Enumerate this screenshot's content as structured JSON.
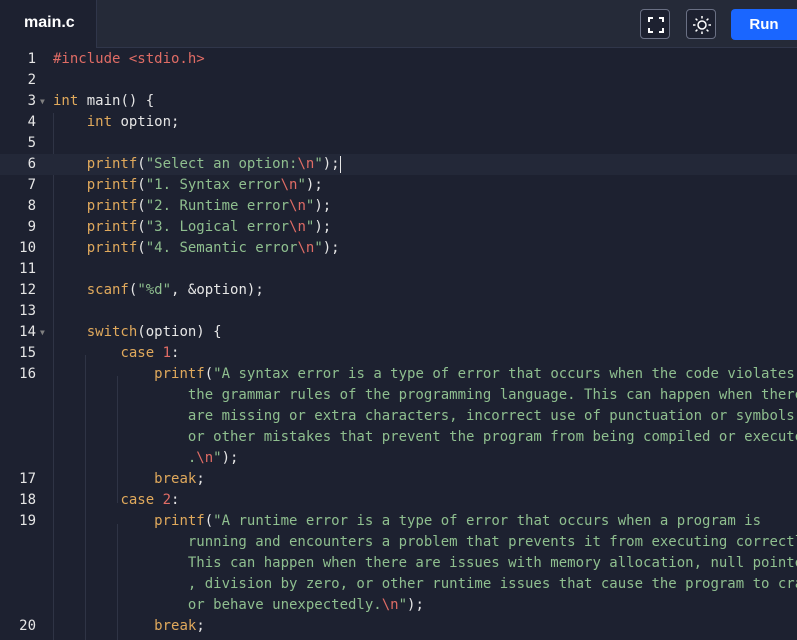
{
  "tab": {
    "filename": "main.c"
  },
  "toolbar": {
    "fullscreen_icon": "fullscreen-icon",
    "theme_icon": "sun-icon",
    "run_label": "Run"
  },
  "colors": {
    "background": "#1d2130",
    "run_button": "#1a66ff",
    "keyword": "#e0a95c",
    "string": "#8fbf8f",
    "escape": "#e06c65"
  },
  "editor": {
    "lines": [
      {
        "n": "1",
        "code": "#include <stdio.h>"
      },
      {
        "n": "2",
        "code": ""
      },
      {
        "n": "3",
        "code": "int main() {"
      },
      {
        "n": "4",
        "code": "    int option;"
      },
      {
        "n": "5",
        "code": ""
      },
      {
        "n": "6",
        "code": "    printf(\"Select an option:\\n\");"
      },
      {
        "n": "7",
        "code": "    printf(\"1. Syntax error\\n\");"
      },
      {
        "n": "8",
        "code": "    printf(\"2. Runtime error\\n\");"
      },
      {
        "n": "9",
        "code": "    printf(\"3. Logical error\\n\");"
      },
      {
        "n": "10",
        "code": "    printf(\"4. Semantic error\\n\");"
      },
      {
        "n": "11",
        "code": ""
      },
      {
        "n": "12",
        "code": "    scanf(\"%d\", &option);"
      },
      {
        "n": "13",
        "code": ""
      },
      {
        "n": "14",
        "code": "    switch(option) {"
      },
      {
        "n": "15",
        "code": "        case 1:"
      },
      {
        "n": "16",
        "code": "            printf(\"A syntax error is a type of error that occurs when the code violates the grammar rules of the programming language. This can happen when there are missing or extra characters, incorrect use of punctuation or symbols, or other mistakes that prevent the program from being compiled or executed.\\n\");"
      },
      {
        "n": "17",
        "code": "            break;"
      },
      {
        "n": "18",
        "code": "        case 2:"
      },
      {
        "n": "19",
        "code": "            printf(\"A runtime error is a type of error that occurs when a program is running and encounters a problem that prevents it from executing correctly. This can happen when there are issues with memory allocation, null pointers, division by zero, or other runtime issues that cause the program to crash or behave unexpectedly.\\n\");"
      },
      {
        "n": "20",
        "code": "            break;"
      }
    ]
  }
}
